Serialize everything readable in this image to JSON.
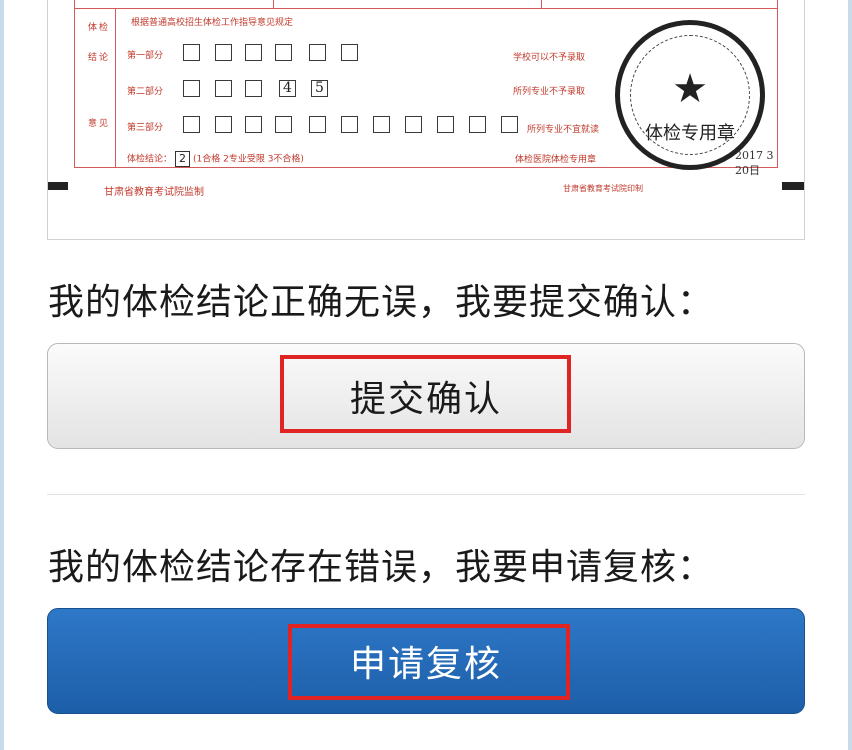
{
  "form": {
    "notice": "根据普通高校招生体检工作指导意见规定",
    "side_labels": [
      "体",
      "检",
      "结",
      "论",
      "意",
      "见"
    ],
    "rows": [
      {
        "label": "第一部分",
        "boxes": [
          "",
          "",
          "",
          "",
          "",
          ""
        ],
        "note": "学校可以不予录取"
      },
      {
        "label": "第二部分",
        "boxes": [
          "",
          "",
          "",
          "4",
          "5"
        ],
        "note": "所列专业不予录取"
      },
      {
        "label": "第三部分",
        "boxes": [
          "",
          "",
          "",
          "",
          "",
          "",
          "",
          "",
          "",
          "",
          ""
        ],
        "note": "所列专业不宜就读"
      }
    ],
    "conclusion_label": "体检结论：",
    "conclusion_value": "2",
    "conclusion_options": "(1合格  2专业受限  3不合格)",
    "sign_label": "体检医院体检专用章",
    "sign_date": "2017  3  20日",
    "footer": "甘肃省教育考试院监制",
    "footer_code": "甘肃省教育考试院印制",
    "stamp_text": "体检专用章"
  },
  "prompt_confirm": "我的体检结论正确无误，我要提交确认：",
  "button_confirm": "提交确认",
  "prompt_review": "我的体检结论存在错误，我要申请复核：",
  "button_review": "申请复核",
  "colors": {
    "form_red": "#c0392b",
    "highlight_red": "#e02424",
    "review_blue": "#1d5ea8"
  }
}
